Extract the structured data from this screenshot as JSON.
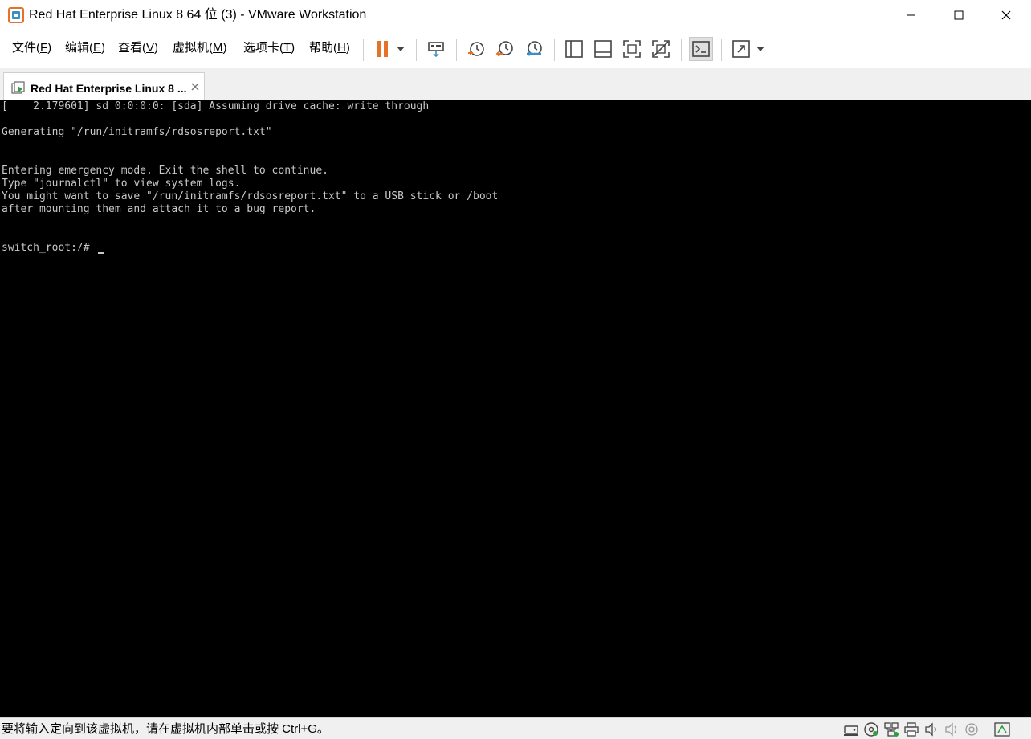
{
  "window": {
    "title": "Red Hat Enterprise Linux 8 64 位 (3) - VMware Workstation"
  },
  "menu": {
    "items": [
      {
        "label": "文件(",
        "key": "F",
        "tail": ")"
      },
      {
        "label": "编辑(",
        "key": "E",
        "tail": ")"
      },
      {
        "label": "查看(",
        "key": "V",
        "tail": ")"
      },
      {
        "label": "虚拟机(",
        "key": "M",
        "tail": ")"
      },
      {
        "label": "选项卡(",
        "key": "T",
        "tail": ")"
      },
      {
        "label": "帮助(",
        "key": "H",
        "tail": ")"
      }
    ]
  },
  "toolbar": {
    "icons": [
      "pause-icon",
      "dropdown-arrow-icon",
      "send-ctrl-alt-del-icon",
      "snapshot-take-icon",
      "snapshot-revert-icon",
      "snapshot-manager-icon",
      "library-view-icon",
      "thumbnail-bar-icon",
      "full-screen-icon",
      "unity-icon",
      "console-view-icon",
      "stretch-guest-icon",
      "dropdown-arrow-icon"
    ],
    "colors": {
      "pause": "#e8712a",
      "accent": "#3a8fc7"
    }
  },
  "tab": {
    "label": "Red Hat Enterprise Linux 8 ..."
  },
  "console": {
    "lines": [
      "[    2.179601] sd 0:0:0:0: [sda] Assuming drive cache: write through",
      "",
      "Generating \"/run/initramfs/rdsosreport.txt\"",
      "",
      "",
      "Entering emergency mode. Exit the shell to continue.",
      "Type \"journalctl\" to view system logs.",
      "You might want to save \"/run/initramfs/rdsosreport.txt\" to a USB stick or /boot",
      "after mounting them and attach it to a bug report.",
      "",
      "",
      "switch_root:/# "
    ]
  },
  "statusbar": {
    "message": "要将输入定向到该虚拟机，请在虚拟机内部单击或按 Ctrl+G。",
    "icons": [
      "hard-disk-icon",
      "cd-dvd-icon",
      "network-adapter-icon",
      "printer-icon",
      "sound-card-icon",
      "audio-icon",
      "usb-icon",
      "message-log-icon"
    ]
  }
}
